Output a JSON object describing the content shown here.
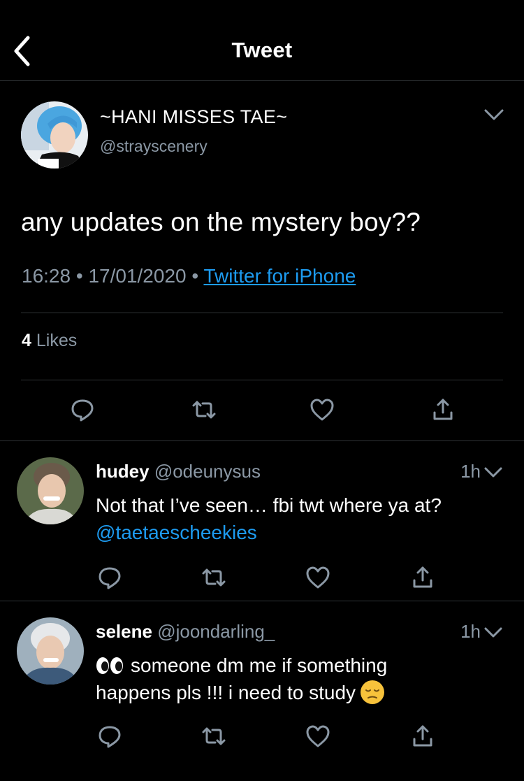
{
  "header": {
    "title": "Tweet"
  },
  "main_tweet": {
    "display_name": "~HANI MISSES TAE~",
    "handle": "@strayscenery",
    "text": "any updates on the mystery boy??",
    "time": "16:28",
    "separator": "•",
    "date": "17/01/2020",
    "source": "Twitter for iPhone",
    "likes_count": "4",
    "likes_label": "Likes"
  },
  "replies": [
    {
      "display_name": "hudey",
      "handle": "@odeunysus",
      "time": "1h",
      "text": "Not that I’ve seen… fbi twt where ya at?",
      "mention": "@taetaescheekies"
    },
    {
      "display_name": "selene",
      "handle": "@joondarling_",
      "time": "1h",
      "text_line1": "someone dm me if something",
      "text_line2": "happens pls !!! i need to study"
    }
  ],
  "icons": {
    "back": "chevron-left-icon",
    "more": "chevron-down-icon",
    "reply": "reply-icon",
    "retweet": "retweet-icon",
    "like": "heart-icon",
    "share": "share-icon"
  },
  "colors": {
    "background": "#000000",
    "accent": "#1d9bf0",
    "secondary_text": "#8b98a5",
    "divider": "#2f3336"
  }
}
